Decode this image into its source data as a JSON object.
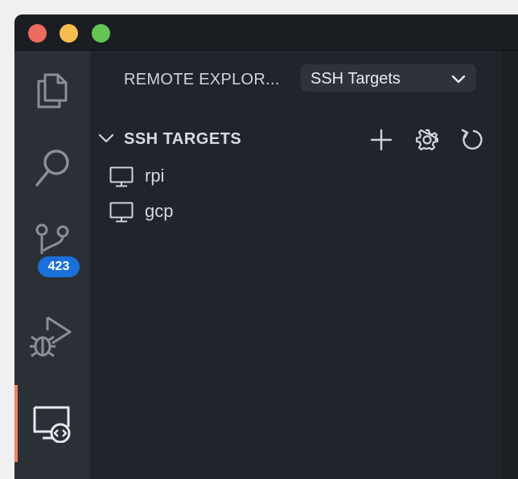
{
  "window": {
    "traffic_lights": [
      "close",
      "minimize",
      "maximize"
    ]
  },
  "activity_bar": {
    "items": [
      {
        "name": "explorer",
        "icon": "files-icon"
      },
      {
        "name": "search",
        "icon": "search-icon"
      },
      {
        "name": "source-control",
        "icon": "source-control-icon",
        "badge": "423"
      },
      {
        "name": "run-debug",
        "icon": "run-debug-icon"
      },
      {
        "name": "remote-explorer",
        "icon": "remote-explorer-icon",
        "active": true
      }
    ]
  },
  "sidebar": {
    "title": "REMOTE EXPLOR...",
    "dropdown": {
      "selected": "SSH Targets"
    },
    "section": {
      "title": "SSH TARGETS",
      "actions": [
        "add-icon",
        "gear-icon",
        "refresh-icon"
      ]
    },
    "targets": [
      {
        "label": "rpi",
        "icon": "monitor-icon"
      },
      {
        "label": "gcp",
        "icon": "monitor-icon"
      }
    ]
  },
  "colors": {
    "activity_bar_bg": "#2b2f36",
    "sidebar_bg": "#21252b",
    "active_indicator": "#ef8163",
    "badge_bg": "#1a6fd8",
    "traffic_red": "#ed6a5e",
    "traffic_yellow": "#f5be4f",
    "traffic_green": "#62c555"
  }
}
